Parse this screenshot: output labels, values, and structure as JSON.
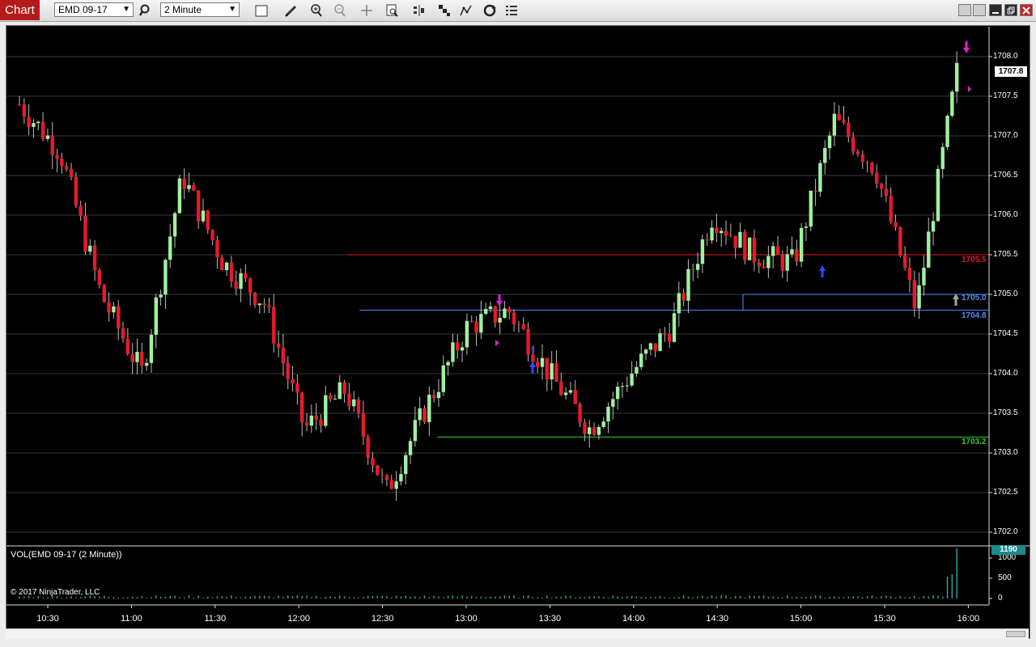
{
  "app": {
    "tab_label": "Chart",
    "instrument": "EMD 09-17",
    "interval": "2 Minute"
  },
  "toolbar_icons": [
    "search-icon",
    "box-icon",
    "pencil-icon",
    "zoom-in-icon",
    "zoom-out-icon",
    "crosshair-icon",
    "data-box-icon",
    "bar-type-icon",
    "properties-icon",
    "strategy-icon",
    "refresh-icon",
    "list-icon"
  ],
  "window_buttons": [
    "restore-icon",
    "minimize-icon",
    "maximize-icon",
    "close-icon"
  ],
  "chart": {
    "price_axis": [
      "1708.0",
      "1707.5",
      "1707.0",
      "1706.5",
      "1706.0",
      "1705.5",
      "1705.0",
      "1704.5",
      "1704.0",
      "1703.5",
      "1703.0",
      "1702.5",
      "1702.0"
    ],
    "time_axis": [
      "10:30",
      "11:00",
      "11:30",
      "12:00",
      "12:30",
      "13:00",
      "13:30",
      "14:00",
      "14:30",
      "15:00",
      "15:30",
      "16:00"
    ],
    "last_price": "1707.8",
    "levels": [
      {
        "label": "1705.5",
        "color": "#e8192c"
      },
      {
        "label": "1705.0",
        "color": "#4f8ff7"
      },
      {
        "label": "1704.8",
        "color": "#4f8ff7"
      },
      {
        "label": "1703.2",
        "color": "#2fd02f"
      }
    ],
    "up_color": "#9ff09f",
    "down_color": "#e8192c"
  },
  "volume": {
    "title": "VOL(EMD 09-17 (2 Minute))",
    "axis": [
      "1000",
      "500",
      "0"
    ],
    "last_volume": "1190"
  },
  "copyright": "© 2017 NinjaTrader, LLC",
  "chart_data": {
    "type": "candlestick",
    "ylim": [
      1702.0,
      1708.2
    ],
    "x": [
      "10:30",
      "11:00",
      "11:30",
      "12:00",
      "12:30",
      "13:00",
      "13:30",
      "14:00",
      "14:30",
      "15:00",
      "15:30",
      "16:00"
    ],
    "anchor_prices": [
      1707.4,
      1706.8,
      1705.0,
      1704.0,
      1706.5,
      1705.4,
      1704.9,
      1703.3,
      1703.8,
      1702.5,
      1703.6,
      1704.6,
      1704.8,
      1704.0,
      1703.3,
      1704.0,
      1704.6,
      1706.0,
      1705.5,
      1705.4,
      1707.2,
      1706.6,
      1704.8,
      1707.8
    ],
    "levels": [
      1705.5,
      1705.0,
      1704.8,
      1703.2
    ]
  }
}
